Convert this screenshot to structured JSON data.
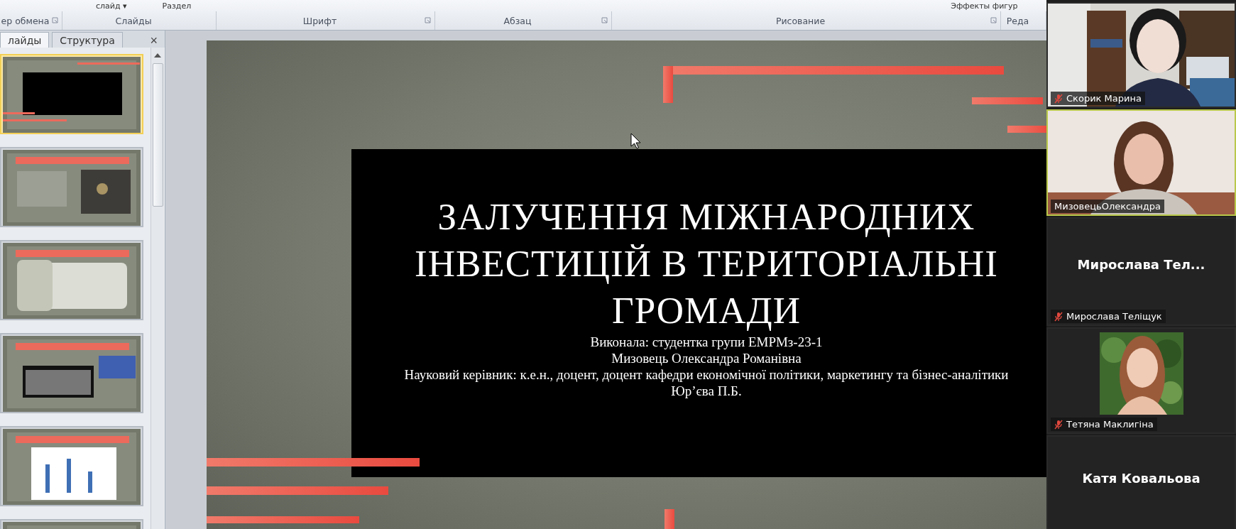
{
  "ribbon": {
    "top_items": [
      {
        "label": "слайд",
        "caret": "▾"
      },
      {
        "label": "Раздел"
      },
      {
        "label": "Эффекты фигур"
      }
    ],
    "groups": [
      {
        "label": "ер обмена",
        "launcher": true
      },
      {
        "label": "Слайды",
        "launcher": false
      },
      {
        "label": "Шрифт",
        "launcher": true
      },
      {
        "label": "Абзац",
        "launcher": true
      },
      {
        "label": "Рисование",
        "launcher": true
      },
      {
        "label": "Реда",
        "launcher": false
      }
    ]
  },
  "side_panel": {
    "tabs": [
      {
        "label": "лайды",
        "selected": true
      },
      {
        "label": "Структура",
        "selected": false
      }
    ],
    "close": "×",
    "slides": [
      {
        "selected": true
      },
      {
        "selected": false
      },
      {
        "selected": false
      },
      {
        "selected": false
      },
      {
        "selected": false
      },
      {
        "selected": false
      }
    ]
  },
  "slide": {
    "title": "ЗАЛУЧЕННЯ МІЖНАРОДНИХ ІНВЕСТИЦІЙ В ТЕРИТОРІАЛЬНІ ГРОМАДИ",
    "subtitle": [
      "Виконала:  студентка групи ЕМРМз-23-1",
      "Мизовець Олександра Романівна",
      "Науковий керівник: к.е.н., доцент, доцент кафедри економічної політики, маркетингу та бізнес-аналітики",
      "Юр’єва П.Б."
    ]
  },
  "participants": [
    {
      "kind": "video",
      "name": "Скорик Марина",
      "muted": true,
      "speaking": false
    },
    {
      "kind": "video",
      "name": "МизовецьОлександра",
      "muted": false,
      "speaking": true
    },
    {
      "kind": "name",
      "display_name": "Мирослава  Тел...",
      "name": "Мирослава Теліщук",
      "muted": true,
      "speaking": false
    },
    {
      "name": "Тетяна Маклигіна",
      "muted": true,
      "speaking": false
    },
    {
      "kind": "name",
      "display_name": "Катя Ковальова",
      "speaking": false
    }
  ]
}
